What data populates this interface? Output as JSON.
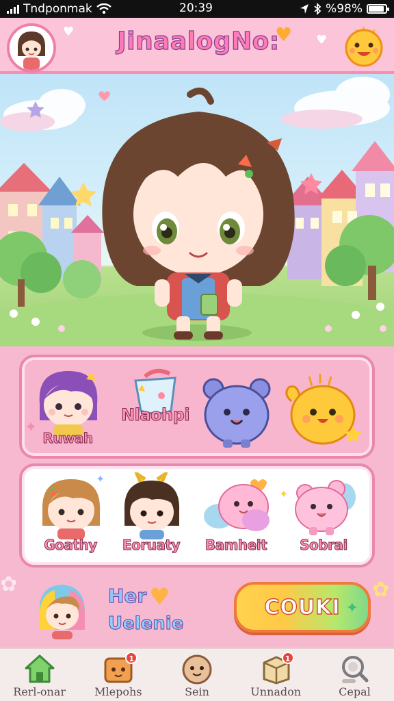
{
  "status_bar": {
    "carrier": "Tndponmak",
    "time": "20:39",
    "battery": "%98%"
  },
  "header": {
    "title": "JinaalogNo:"
  },
  "characters_top": [
    {
      "label": "Ruwah"
    },
    {
      "label": "Nlaohpi"
    },
    {
      "label": ""
    },
    {
      "label": ""
    }
  ],
  "characters_bottom": [
    {
      "label": "Goathy"
    },
    {
      "label": "Eoruaty"
    },
    {
      "label": "Bamheit"
    },
    {
      "label": "Sobrai"
    }
  ],
  "promo": {
    "line1": "Her",
    "line2": "Uelenie"
  },
  "cta": {
    "label": "COUKI"
  },
  "nav": [
    {
      "label": "Rerl-onar",
      "icon": "home-icon"
    },
    {
      "label": "Mlepohs",
      "icon": "box-icon",
      "badge": "1"
    },
    {
      "label": "Sein",
      "icon": "face-icon"
    },
    {
      "label": "Unnadon",
      "icon": "crate-icon",
      "badge": "1"
    },
    {
      "label": "Cepal",
      "icon": "search-icon"
    }
  ],
  "colors": {
    "accent_pink": "#f48fb1",
    "title_pink": "#ff7ab6",
    "nav_bg": "#f4ecea",
    "badge_red": "#e8453c"
  }
}
